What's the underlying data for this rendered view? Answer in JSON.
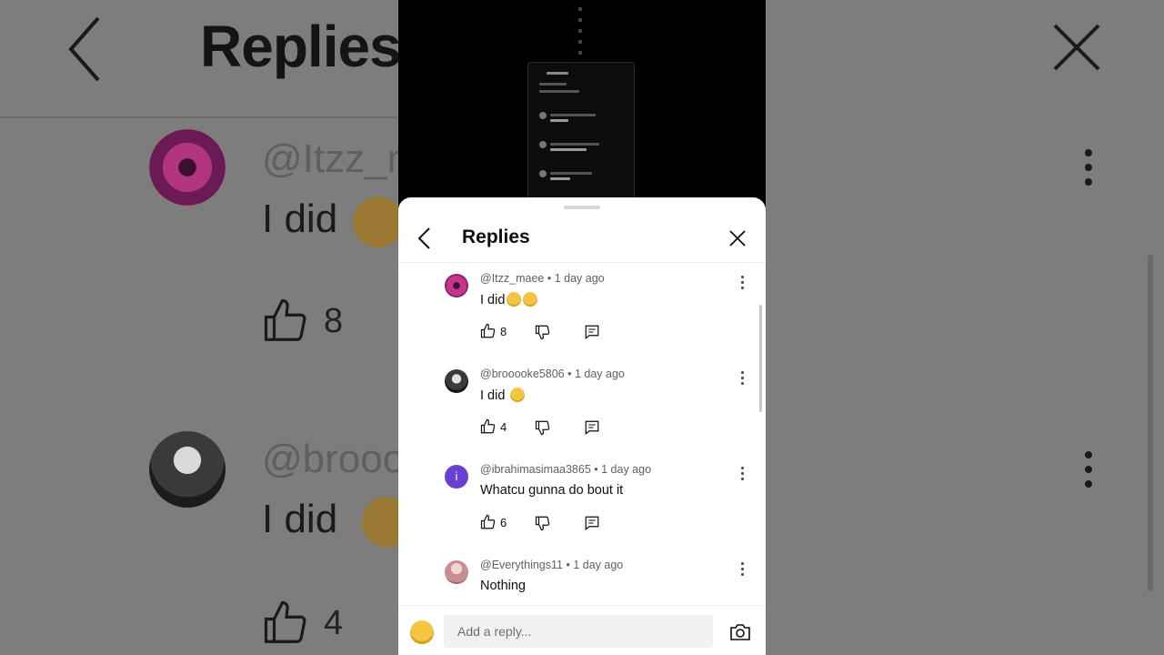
{
  "background": {
    "title": "Replies",
    "comments": [
      {
        "handle": "@Itzz_m",
        "text": "I did",
        "likes": "8"
      },
      {
        "handle": "@brooo",
        "text": "I did",
        "likes": "4"
      }
    ]
  },
  "sheet": {
    "title": "Replies",
    "replies": [
      {
        "handle": "@Itzz_maee",
        "age": "1 day ago",
        "text": "I did",
        "emoji_count": 2,
        "likes": "8",
        "avatar_color": "#c2378a"
      },
      {
        "handle": "@brooooke5806",
        "age": "1 day ago",
        "text": "I did",
        "emoji_count": 1,
        "likes": "4",
        "avatar_color": "#2b2b2b"
      },
      {
        "handle": "@ibrahimasimaa3865",
        "age": "1 day ago",
        "text": "Whatcu gunna do bout it",
        "emoji_count": 0,
        "likes": "6",
        "avatar_color": "#6a3fd1",
        "avatar_letter": "i"
      },
      {
        "handle": "@Everythings11",
        "age": "1 day ago",
        "text": "Nothing",
        "emoji_count": 0,
        "likes": "",
        "avatar_color": "#c98f8f"
      }
    ],
    "composer": {
      "placeholder": "Add a reply..."
    }
  },
  "colors": {
    "sheet_bg": "#ffffff",
    "accent_text": "#0f0f0f",
    "muted_text": "#606060"
  },
  "icons": [
    "back-chevron-icon",
    "close-icon",
    "thumb-up-icon",
    "thumb-down-icon",
    "reply-icon",
    "more-vert-icon",
    "camera-icon"
  ]
}
